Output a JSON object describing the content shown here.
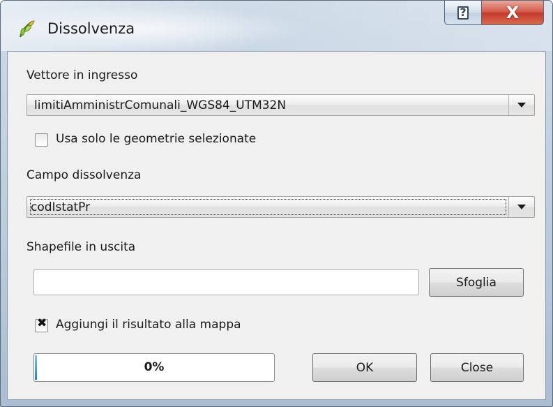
{
  "window": {
    "title": "Dissolvenza",
    "help_glyph": "?",
    "close_glyph": "X",
    "app_icon": "qgis-dissolve-icon"
  },
  "form": {
    "input_layer_label": "Vettore in ingresso",
    "input_layer_value": "limitiAmministrComunali_WGS84_UTM32N",
    "use_selected_label": "Usa solo le geometrie selezionate",
    "use_selected_checked": false,
    "dissolve_field_label": "Campo dissolvenza",
    "dissolve_field_value": "codIstatPr",
    "output_label": "Shapefile in uscita",
    "output_value": "",
    "browse_label": "Sfoglia",
    "add_to_map_label": "Aggiungi il risultato alla mappa",
    "add_to_map_checked": true,
    "add_to_map_mark": "✖"
  },
  "footer": {
    "progress_value": 0,
    "progress_text": "0%",
    "ok_label": "OK",
    "close_label": "Close"
  },
  "colors": {
    "close_button": "#c53a2b",
    "progress_fill": "#1d7ee0"
  }
}
